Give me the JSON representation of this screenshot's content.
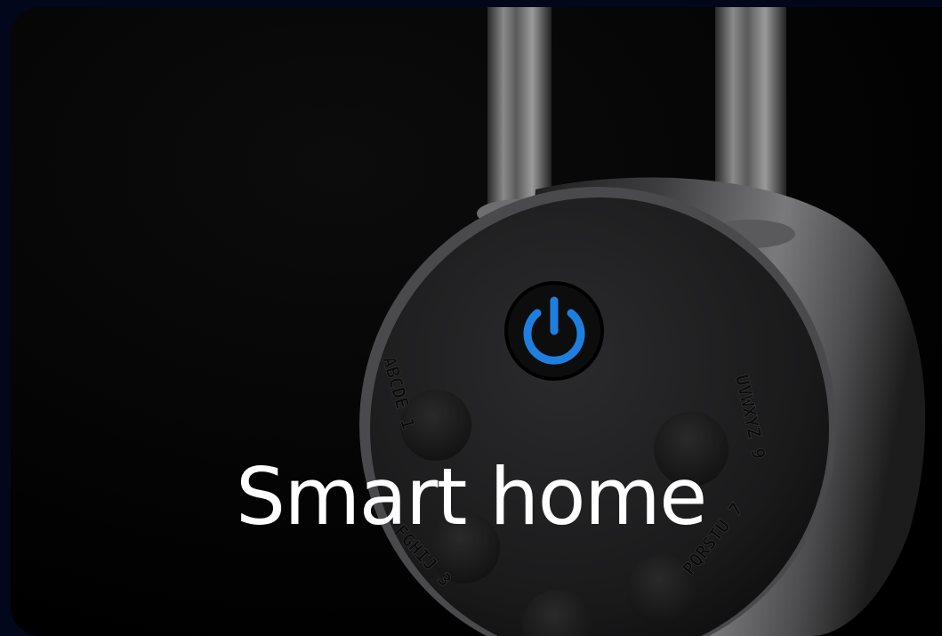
{
  "card": {
    "title": "Smart home",
    "image": {
      "subject": "smart padlock",
      "keypad_letters": [
        "ABCDE 1",
        "FGHIJ 3",
        "UVWXYZ 9",
        "PQRSTU 7"
      ],
      "power_icon": "power-icon"
    }
  },
  "colors": {
    "page_background": "#02071c",
    "card_background": "#000000",
    "accent_power": "#1e7fe0",
    "title": "#ffffff"
  }
}
